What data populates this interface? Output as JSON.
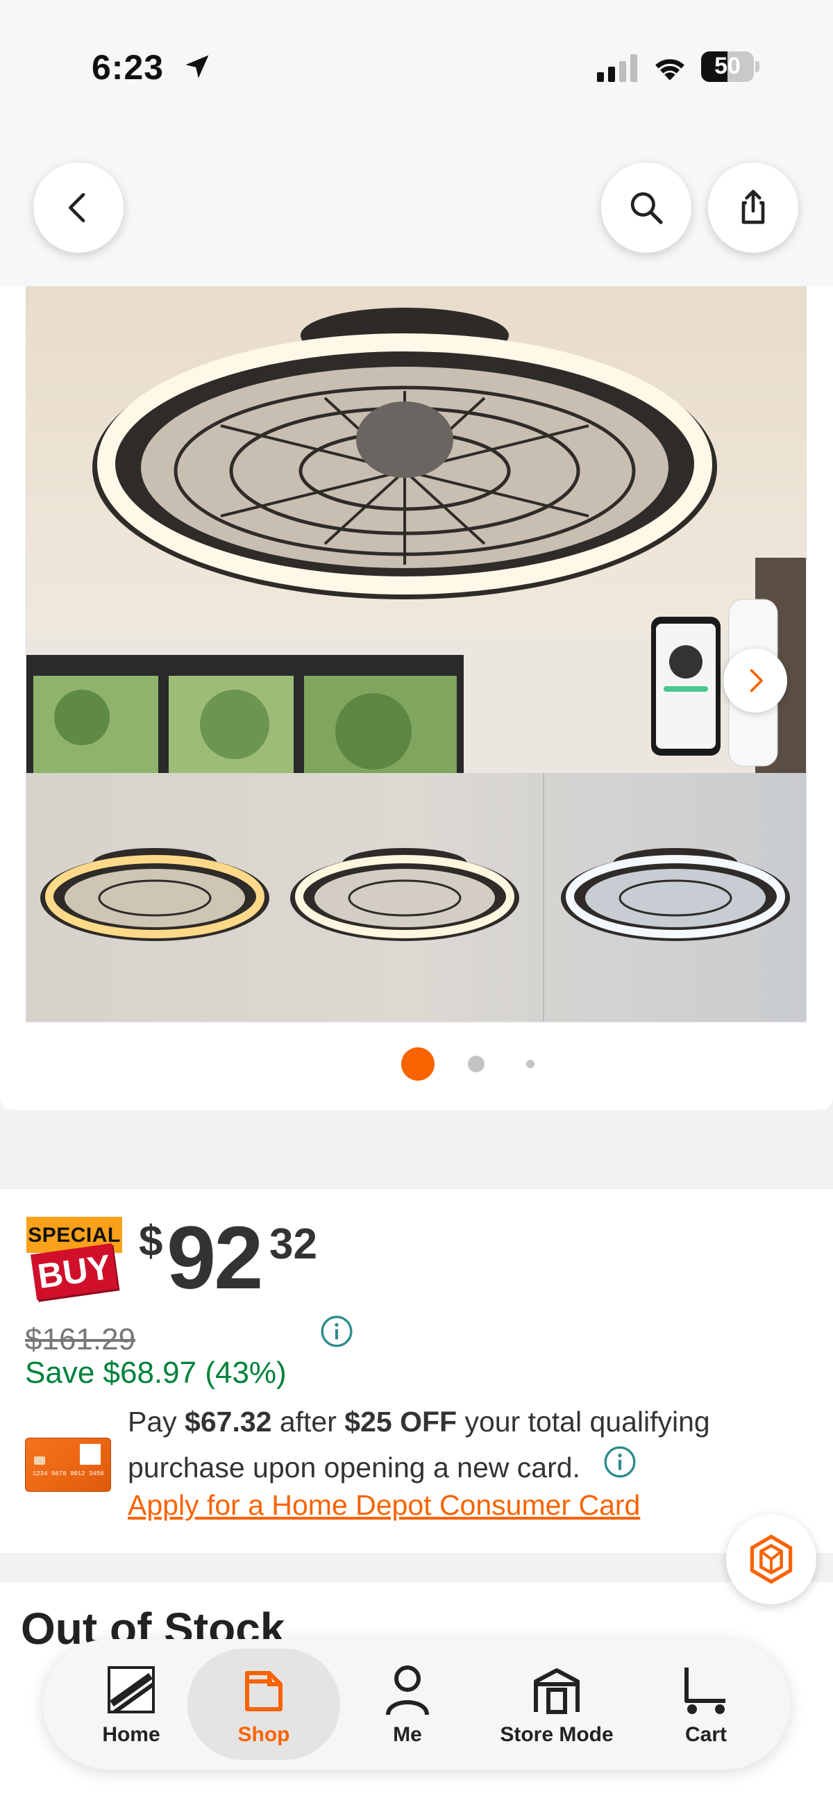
{
  "status": {
    "time": "6:23",
    "battery": "50",
    "battery_level": 0.5
  },
  "header": {
    "back_icon": "chevron-left-icon",
    "search_icon": "search-icon",
    "share_icon": "share-icon"
  },
  "media": {
    "image_alt": "Caged ceiling fan with LED ring light, app control on phone and remote",
    "image_count": 3,
    "current_index": 0,
    "next_icon": "chevron-right-icon"
  },
  "pricing": {
    "badge_top": "SPECIAL",
    "badge_bottom": "BUY",
    "currency": "$",
    "price_whole": "92",
    "price_cents": "32",
    "was_price": "$161.29",
    "savings": "Save $68.97 (43%)",
    "card_offer": {
      "pay_prefix": "Pay ",
      "pay_amount": "$67.32",
      "after": " after ",
      "discount": "$25 OFF",
      "suffix": " your total qualifying purchase upon opening a new card.",
      "apply_link": "Apply for a Home Depot Consumer Card",
      "card_number": "1234 5678 9012 3456"
    }
  },
  "stock": {
    "title": "Out of Stock"
  },
  "bottom_nav": {
    "items": [
      {
        "label": "Home",
        "icon": "home-depot-logo-icon"
      },
      {
        "label": "Shop",
        "icon": "shop-icon",
        "active": true
      },
      {
        "label": "Me",
        "icon": "person-icon"
      },
      {
        "label": "Store Mode",
        "icon": "store-icon"
      },
      {
        "label": "Cart",
        "icon": "cart-icon"
      }
    ]
  },
  "colors": {
    "accent": "#f96302",
    "savings": "#00823b",
    "info": "#2e8b8b",
    "special_orange": "#f9a11b",
    "special_red": "#d0102b"
  }
}
